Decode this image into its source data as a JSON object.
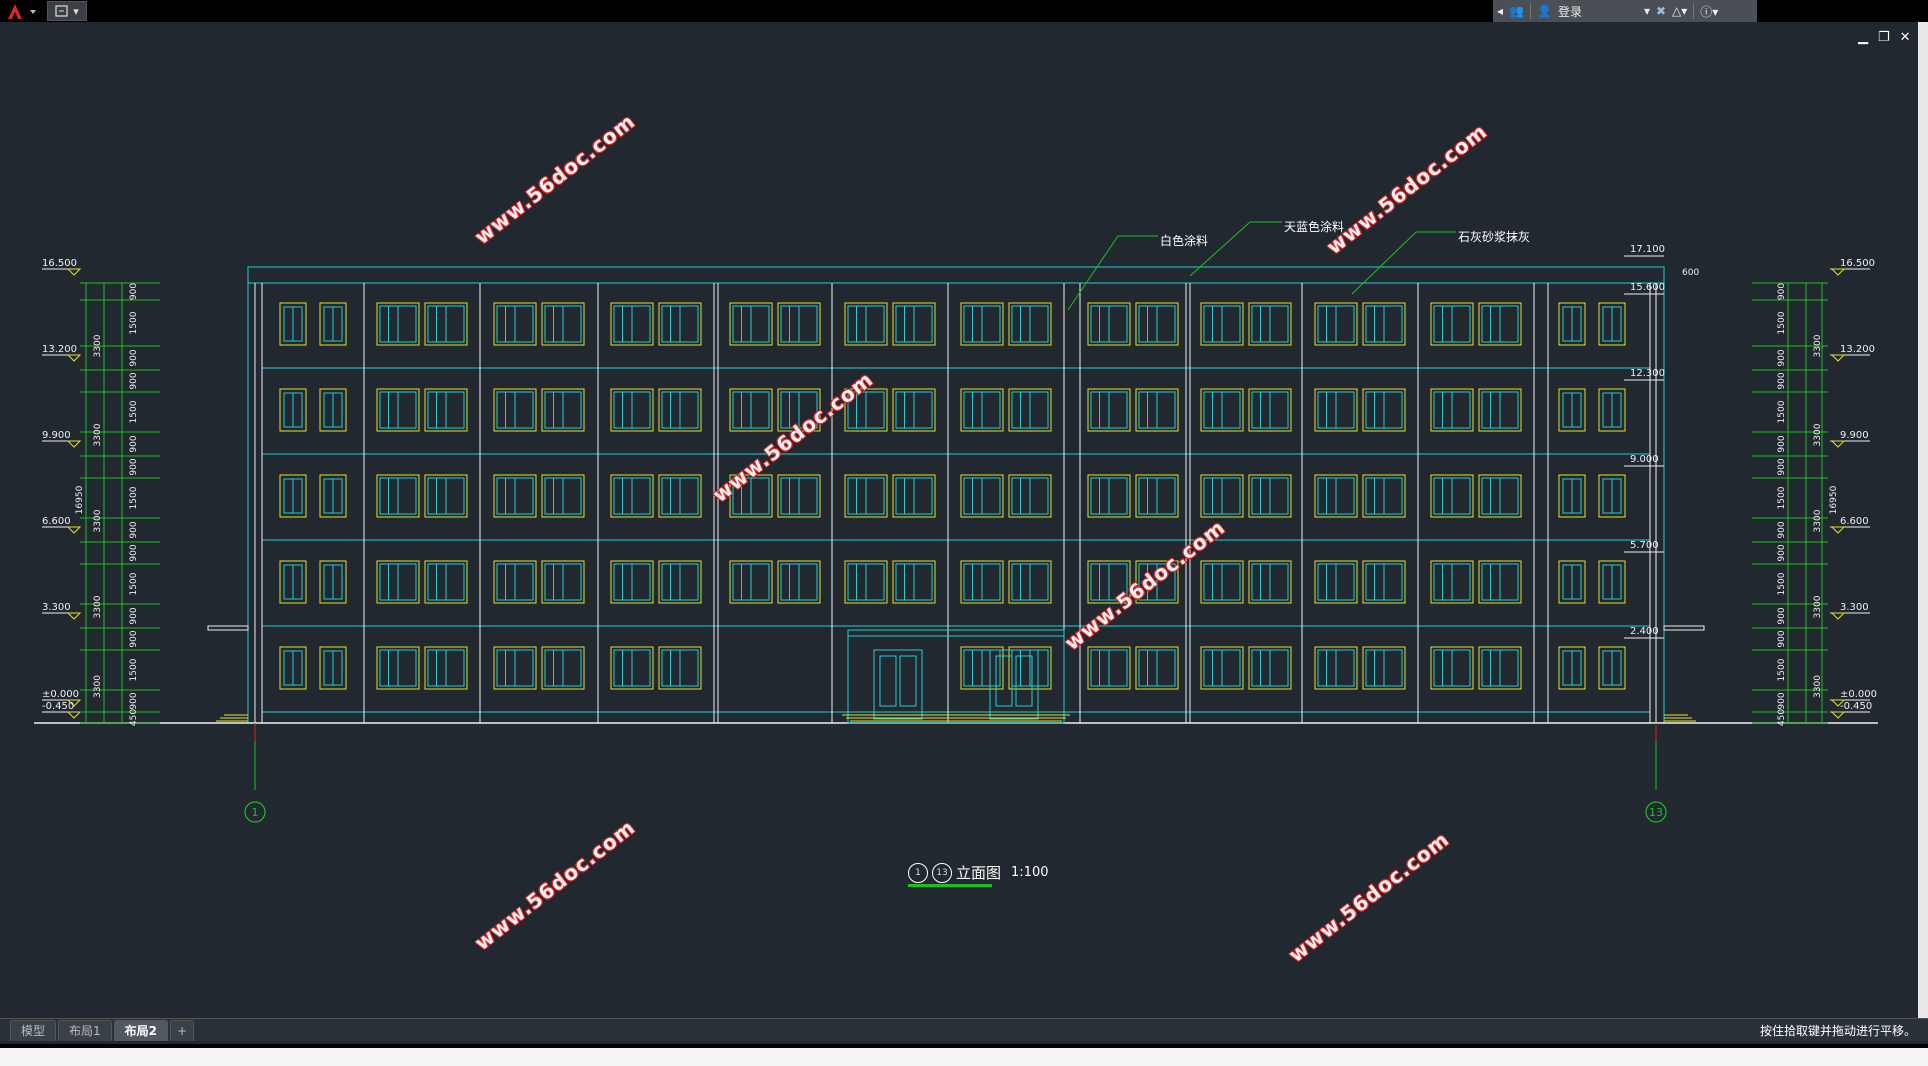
{
  "toolbar": {
    "app_menu_icon": "autocad-logo-icon",
    "quick_access_icon": "save-dropdown-icon",
    "login_label": "登录"
  },
  "window": {
    "minimize": "▁",
    "restore": "❐",
    "close": "✕"
  },
  "drawing": {
    "notes": {
      "white_paint": "白色涂料",
      "sky_blue_paint": "天蓝色涂料",
      "lime_plaster": "石灰砂浆抹灰"
    },
    "left_levels": [
      "16.500",
      "13.200",
      "9.900",
      "6.600",
      "3.300",
      "±0.000",
      "-0.450"
    ],
    "right_levels": [
      "16.500",
      "13.200",
      "9.900",
      "6.600",
      "3.300",
      "±0.000",
      "-0.450"
    ],
    "inner_levels": [
      "17.100",
      "15.600",
      "12.300",
      "9.000",
      "5.700",
      "2.400"
    ],
    "left_dims_inner": [
      "900",
      "1500",
      "900",
      "900",
      "1500",
      "900",
      "900",
      "1500",
      "900",
      "900",
      "1500",
      "900",
      "900",
      "1500",
      "900",
      "450"
    ],
    "left_dims_outer": [
      "3300",
      "3300",
      "3300",
      "3300",
      "3300"
    ],
    "total_height": "16950",
    "parapet": "600",
    "axis_left": "1",
    "axis_right": "13",
    "title_from": "1",
    "title_to": "13",
    "title_text": "立面图",
    "scale": "1:100"
  },
  "watermarks": [
    "www.56doc.com",
    "www.56doc.com",
    "www.56doc.com",
    "www.56doc.com",
    "www.56doc.com",
    "www.56doc.com"
  ],
  "tabs": [
    {
      "label": "模型",
      "active": false
    },
    {
      "label": "布局1",
      "active": false
    },
    {
      "label": "布局2",
      "active": true
    },
    {
      "label": "+",
      "active": false
    }
  ],
  "status": {
    "message": "按住拾取键并拖动进行平移。"
  },
  "colors": {
    "background": "#212830",
    "cyan": "#1fd0d0",
    "yellow": "#e6e02a",
    "green": "#1ec01e",
    "white": "#f0f0f0"
  }
}
